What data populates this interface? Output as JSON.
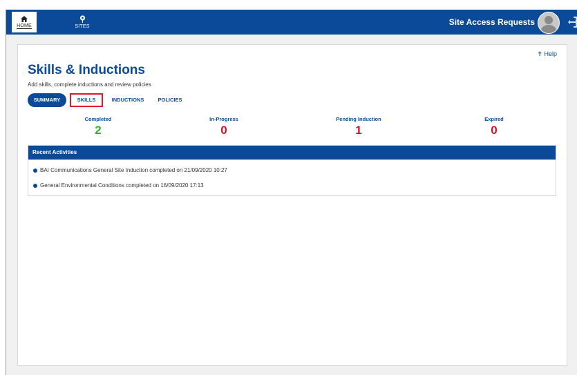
{
  "topbar": {
    "nav": [
      {
        "label": "HOME",
        "icon": "home-icon",
        "active": true
      },
      {
        "label": "SITES",
        "icon": "sites-pin-icon",
        "active": false
      }
    ],
    "app_title": "Site Access Requests",
    "accent_color": "#0a4a99"
  },
  "page": {
    "help_label": "Help",
    "title": "Skills & Inductions",
    "subtitle": "Add skills, complete inductions and review policies",
    "tabs": [
      {
        "label": "SUMMARY",
        "selected": true
      },
      {
        "label": "SKILLS",
        "highlighted": true
      },
      {
        "label": "INDUCTIONS"
      },
      {
        "label": "POLICIES"
      }
    ]
  },
  "stats": [
    {
      "label": "Completed",
      "value": "2",
      "color": "#2bb52b"
    },
    {
      "label": "In-Progress",
      "value": "0",
      "color": "#d3102a"
    },
    {
      "label": "Pending Induction",
      "value": "1",
      "color": "#d3102a"
    },
    {
      "label": "Expired",
      "value": "0",
      "color": "#d3102a"
    }
  ],
  "recent": {
    "header": "Recent Activities",
    "items": [
      "BAI Communications General Site Induction completed on 21/09/2020 10:27",
      "General Environmental Conditions completed on 16/09/2020 17:13"
    ]
  }
}
